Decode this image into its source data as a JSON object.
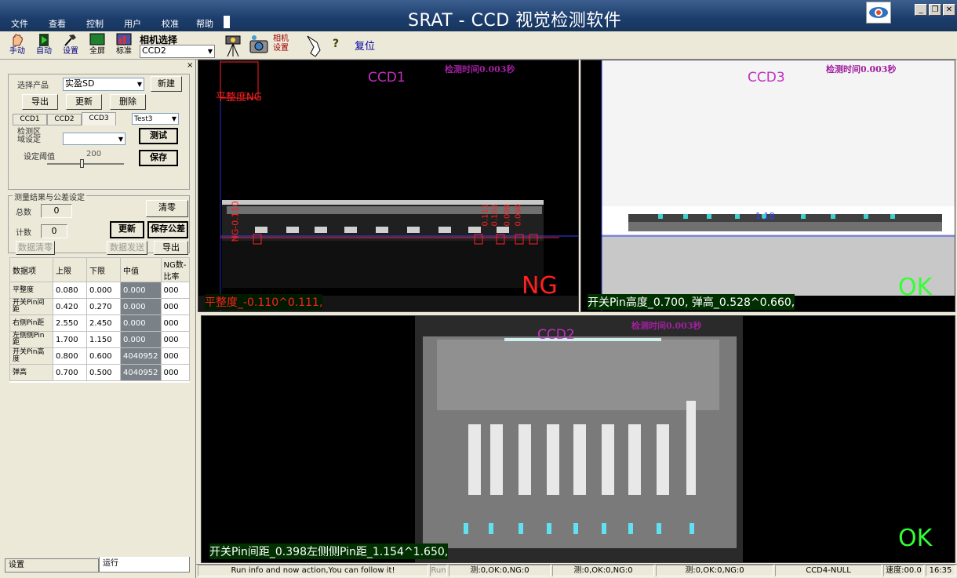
{
  "app": {
    "title": "SRAT - CCD 视觉检测软件",
    "menu": [
      "文件",
      "查看",
      "控制",
      "用户",
      "校准",
      "帮助"
    ]
  },
  "toolbar": {
    "manual": "手动",
    "auto": "自动",
    "settings": "设置",
    "fullscreen": "全屏",
    "standard": "标准",
    "camera_select_label": "相机选择",
    "camera_value": "CCD2",
    "camera_settings": "相机\n设置",
    "reset": "复位"
  },
  "left": {
    "select_product_label": "选择产品",
    "product_value": "实盈SD",
    "new_btn": "新建",
    "export_btn": "导出",
    "update_btn": "更新",
    "delete_btn": "删除",
    "tabs": [
      "CCD1",
      "CCD2",
      "CCD3"
    ],
    "test_select": "Test3",
    "region_label": "检测区\n域设定",
    "test_btn": "测试",
    "threshold_label": "设定阈值",
    "threshold_value": "200",
    "threshold_level": 0.45,
    "save_btn": "保存",
    "section_title": "测量结果与公差设定",
    "total_label": "总数",
    "total_value": "0",
    "clear_btn": "清零",
    "count_label": "计数",
    "count_value": "0",
    "update2_btn": "更新",
    "save_tol_btn": "保存公差",
    "data_clear_btn": "数据清零",
    "data_send_btn": "数据发送",
    "export2_btn": "导出",
    "table": {
      "headers": [
        "数据项",
        "上限",
        "下限",
        "中值",
        "NG数-比率"
      ],
      "rows": [
        [
          "平整度",
          "0.080",
          "0.000",
          "0.000",
          "000"
        ],
        [
          "开关Pin间距",
          "0.420",
          "0.270",
          "0.000",
          "000"
        ],
        [
          "右侧Pin距",
          "2.550",
          "2.450",
          "0.000",
          "000"
        ],
        [
          "左侧侧Pin距",
          "1.700",
          "1.150",
          "0.000",
          "000"
        ],
        [
          "开关Pin高度",
          "0.800",
          "0.600",
          "4040952",
          "000"
        ],
        [
          "弹高",
          "0.700",
          "0.500",
          "4040952",
          "000"
        ]
      ]
    },
    "bottom_tabs": [
      "设置",
      "运行"
    ]
  },
  "views": {
    "ccd1": {
      "title": "CCD1",
      "time": "检测时间0.003秒",
      "roi_label": "平整度NG",
      "result": "NG",
      "measure": "平整度_-0.110^0.111,",
      "vlabel_left": "NG-0.110",
      "vlabels_right": [
        "0.111",
        "0.103",
        "0.099",
        "0.090"
      ]
    },
    "ccd3": {
      "title": "CCD3",
      "time": "检测时间0.003秒",
      "result": "OK",
      "measure": "开关Pin高度_0.700, 弹高_0.528^0.660,",
      "mid_label": "1.18"
    },
    "ccd2": {
      "title": "CCD2",
      "time": "检测时间0.003秒",
      "result": "OK",
      "measure": "开关Pin间距_0.398左侧侧Pin距_1.154^1.650,"
    }
  },
  "status": {
    "info": "Run info and now action,You can follow it!",
    "run": "Run",
    "c1": "测:0,OK:0,NG:0",
    "c2": "测:0,OK:0,NG:0",
    "c3": "测:0,OK:0,NG:0",
    "ccd4": "CCD4-NULL",
    "speed": "速度:00.0",
    "time": "16:35"
  },
  "colors": {
    "title_bar": "#1c3d6c",
    "ok": "#33ff33",
    "ng": "#ff2020",
    "ccd_title": "#c030c0"
  }
}
